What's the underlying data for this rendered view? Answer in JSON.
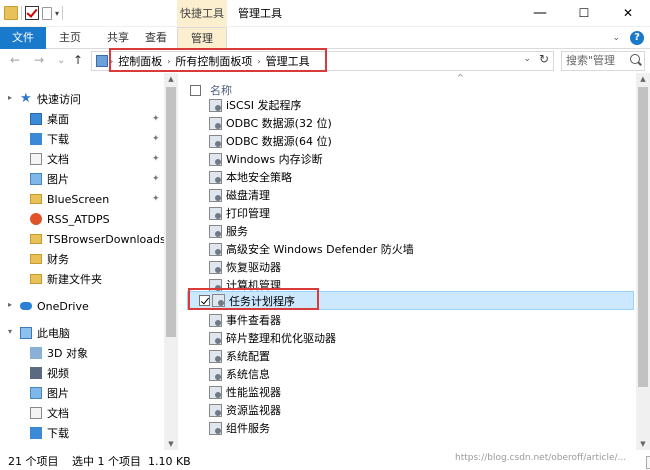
{
  "window": {
    "title": "管理工具",
    "context_tab_group": "快捷工具",
    "minimize": "—",
    "maximize": "☐",
    "close": "✕"
  },
  "ribbon": {
    "tabs": [
      "文件",
      "主页",
      "共享",
      "查看",
      "管理"
    ],
    "collapse_icon": "chevron-down",
    "help": "?"
  },
  "navigation": {
    "back": "←",
    "forward": "→",
    "recent": "⌄",
    "up": "↑"
  },
  "address_bar": {
    "crumbs": [
      "控制面板",
      "所有控制面板项",
      "管理工具"
    ],
    "refresh": "↻"
  },
  "search": {
    "placeholder": "搜索\"管理"
  },
  "nav_pane": {
    "items": [
      {
        "label": "快速访问",
        "icon": "star-icon",
        "pinned": false
      },
      {
        "label": "桌面",
        "icon": "desktop-folder-icon",
        "pinned": true
      },
      {
        "label": "下载",
        "icon": "download-folder-icon",
        "pinned": true
      },
      {
        "label": "文档",
        "icon": "documents-folder-icon",
        "pinned": true
      },
      {
        "label": "图片",
        "icon": "pictures-folder-icon",
        "pinned": true
      },
      {
        "label": "BlueScreen",
        "icon": "folder-icon",
        "pinned": true
      },
      {
        "label": "RSS_ATDPS",
        "icon": "app-icon",
        "pinned": false
      },
      {
        "label": "TSBrowserDownloads",
        "icon": "folder-icon",
        "pinned": false
      },
      {
        "label": "财务",
        "icon": "folder-icon",
        "pinned": false
      },
      {
        "label": "新建文件夹",
        "icon": "folder-icon",
        "pinned": false
      },
      {
        "label": "OneDrive",
        "icon": "onedrive-icon",
        "pinned": false
      },
      {
        "label": "此电脑",
        "icon": "computer-icon",
        "pinned": false
      },
      {
        "label": "3D 对象",
        "icon": "3d-objects-icon",
        "pinned": false
      },
      {
        "label": "视频",
        "icon": "videos-folder-icon",
        "pinned": false
      },
      {
        "label": "图片",
        "icon": "pictures-folder-icon",
        "pinned": false
      },
      {
        "label": "文档",
        "icon": "documents-folder-icon",
        "pinned": false
      },
      {
        "label": "下载",
        "icon": "download-folder-icon",
        "pinned": false
      }
    ]
  },
  "content": {
    "column_name": "名称",
    "items": [
      "iSCSI 发起程序",
      "ODBC 数据源(32 位)",
      "ODBC 数据源(64 位)",
      "Windows 内存诊断",
      "本地安全策略",
      "磁盘清理",
      "打印管理",
      "服务",
      "高级安全 Windows Defender 防火墙",
      "恢复驱动器",
      "计算机管理",
      "任务计划程序",
      "事件查看器",
      "碎片整理和优化驱动器",
      "系统配置",
      "系统信息",
      "性能监视器",
      "资源监视器",
      "组件服务"
    ],
    "selected_index": 11
  },
  "status_bar": {
    "item_count": "21 个项目",
    "selection": "选中 1 个项目  1.10 KB",
    "watermark": "https://blog.csdn.net/oberoff/article/..."
  },
  "colors": {
    "accent": "#1979ca",
    "context_tab": "#fbefd0",
    "selection": "#cce8ff",
    "highlight_box": "#d93b3b"
  }
}
